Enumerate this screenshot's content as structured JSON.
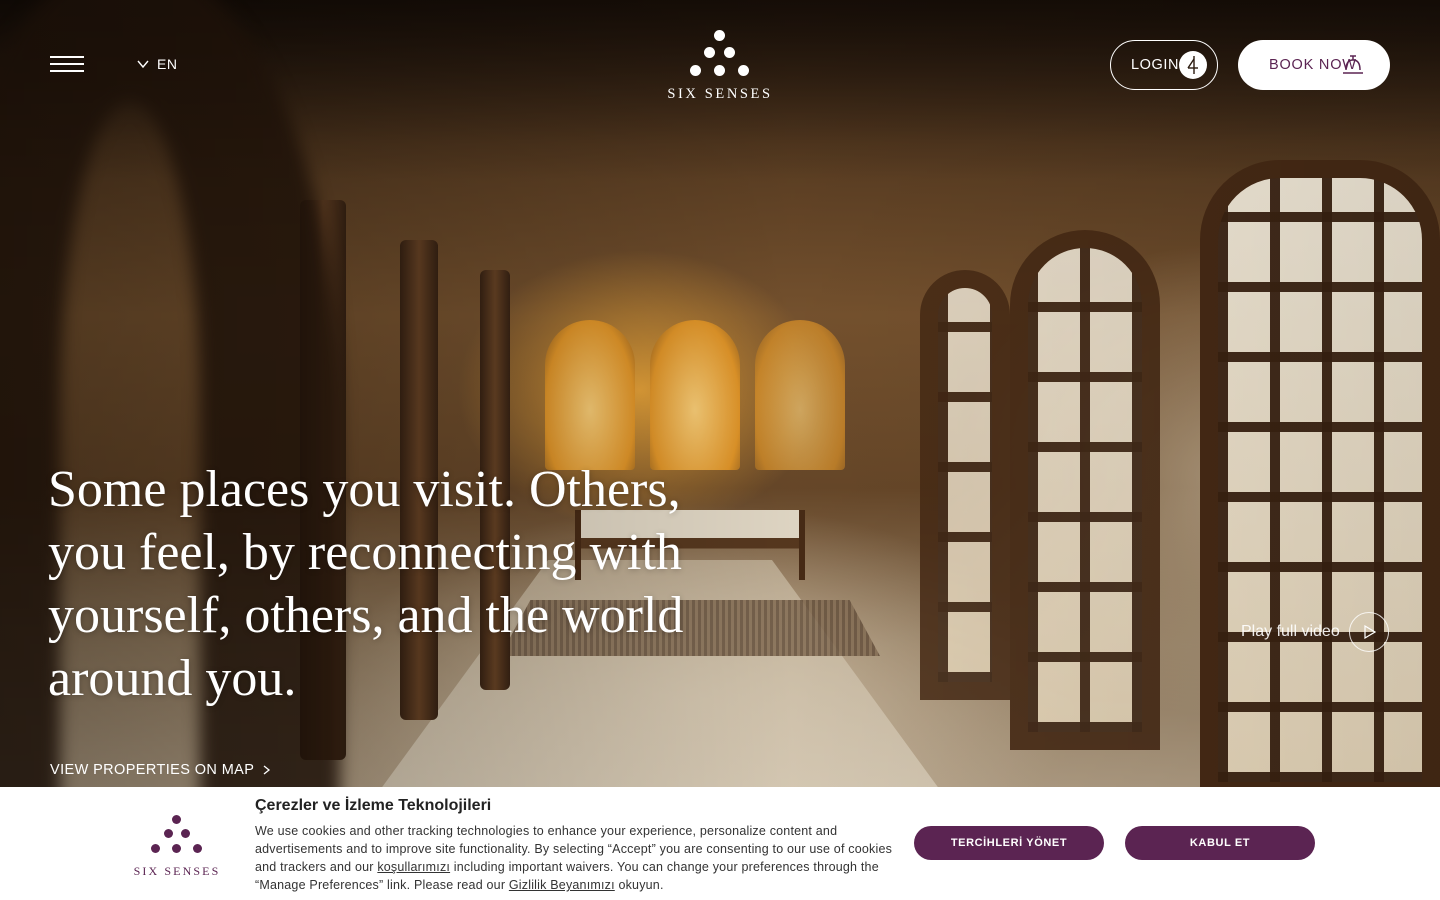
{
  "header": {
    "language": "EN",
    "logo_text": "SIX SENSES",
    "login_label": "LOGIN",
    "book_label": "BOOK NOW"
  },
  "hero": {
    "headline": "Some places you visit. Others, you feel, by reconnecting with yourself, others, and the world around you.",
    "play_video_label": "Play full video",
    "map_link_label": "VIEW PROPERTIES ON MAP"
  },
  "cookie_banner": {
    "logo_text": "SIX SENSES",
    "title": "Çerezler ve İzleme Teknolojileri",
    "text_part1": "We use cookies and other tracking technologies to enhance your experience, personalize content and advertisements and to improve site functionality. By selecting “Accept” you are consenting to our use of cookies and trackers and our ",
    "terms_link": "koşullarımızı",
    "text_part2": " including important waivers. You can change your preferences through the “Manage Preferences” link. Please read our ",
    "privacy_link": "Gizlilik Beyanımızı",
    "text_part3": " okuyun.",
    "manage_label": "TERCİHLERİ YÖNET",
    "accept_label": "KABUL ET"
  },
  "colors": {
    "brand_plum": "#5b2452",
    "white": "#ffffff"
  },
  "icons": {
    "menu": "hamburger-icon",
    "language": "chevron-down-icon",
    "login": "key-icon",
    "book": "service-bell-icon",
    "play": "play-icon",
    "map_arrow": "chevron-right-icon"
  }
}
